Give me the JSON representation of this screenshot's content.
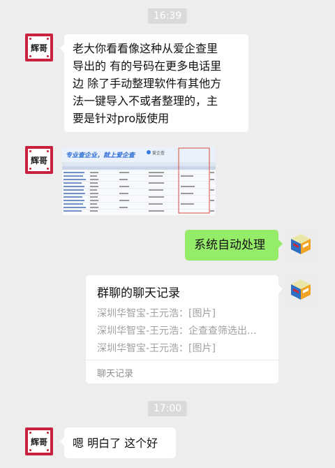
{
  "chat": {
    "time1": "16:39",
    "time2": "17:00",
    "sender_avatar_text": "辉哥",
    "msg1_lines": [
      "老大你看看像这种从爱企查里",
      "导出的 有的号码在更多电话里",
      "边 除了手动整理软件有其他方",
      "法一键导入不或者整理的，主",
      "要是针对pro版使用"
    ],
    "image_banner": "专业查企业，就上爱企查",
    "image_logo": "爱企查",
    "reply1": "系统自动处理",
    "card": {
      "title": "群聊的聊天记录",
      "lines": [
        "深圳华智宝-王元浩：[图片]",
        "深圳华智宝-王元浩：企查查筛选出...",
        "深圳华智宝-王元浩：[图片]"
      ],
      "footer": "聊天记录"
    },
    "msg_last": "嗯 明白了 这个好"
  },
  "colors": {
    "background": "#ededed",
    "bubble_in": "#ffffff",
    "bubble_out": "#95ec69",
    "avatar_frame": "#c8203d"
  }
}
